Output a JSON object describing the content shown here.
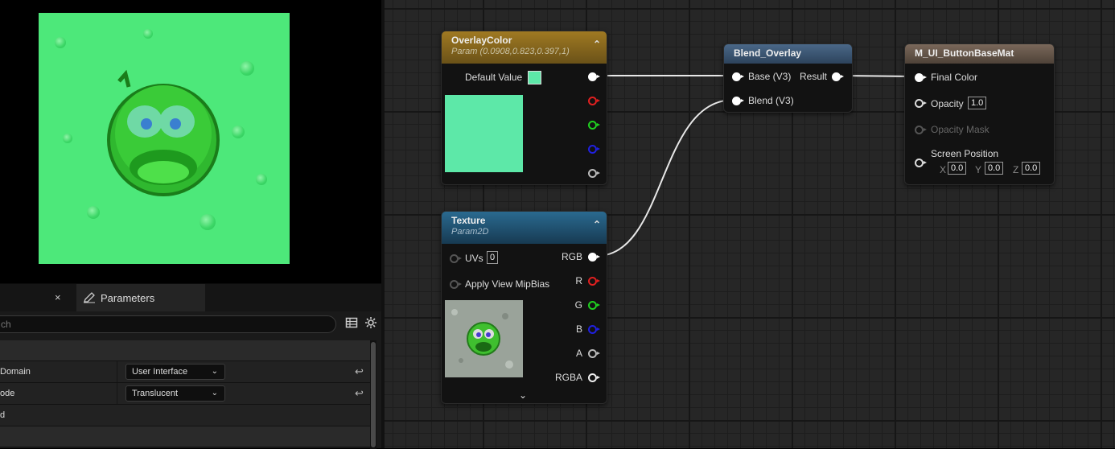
{
  "details": {
    "tab_close": "×",
    "tab_label": "Parameters",
    "search_placeholder": "ch",
    "rows": [
      {
        "label": "Domain",
        "value": "User Interface"
      },
      {
        "label": "ode",
        "value": "Translucent"
      },
      {
        "label": "d",
        "value": ""
      }
    ]
  },
  "nodes": {
    "overlay": {
      "title": "OverlayColor",
      "subtitle": "Param (0.0908,0.823,0.397,1)",
      "default_label": "Default Value",
      "swatch_color": "#5de8a8"
    },
    "texture": {
      "title": "Texture",
      "subtitle": "Param2D",
      "uvs_label": "UVs",
      "uvs_value": "0",
      "mip_label": "Apply View MipBias",
      "outputs": [
        "RGB",
        "R",
        "G",
        "B",
        "A",
        "RGBA"
      ]
    },
    "blend": {
      "title": "Blend_Overlay",
      "base_label": "Base (V3)",
      "blend_label": "Blend (V3)",
      "result_label": "Result"
    },
    "material": {
      "title": "M_UI_ButtonBaseMat",
      "final_color": "Final Color",
      "opacity": "Opacity",
      "opacity_value": "1.0",
      "opacity_mask": "Opacity Mask",
      "screen_position": "Screen Position",
      "x_label": "X",
      "x_value": "0.0",
      "y_label": "Y",
      "y_value": "0.0",
      "z_label": "Z",
      "z_value": "0.0"
    }
  },
  "colors": {
    "preview_green": "#4de87a",
    "overlay_header": "#8a6a1e",
    "texture_header": "#1f4f6e",
    "blend_header": "#3d5673",
    "material_header": "#6b5a4e",
    "pin_r": "#e02020",
    "pin_g": "#20d020",
    "pin_b": "#2020e0"
  }
}
